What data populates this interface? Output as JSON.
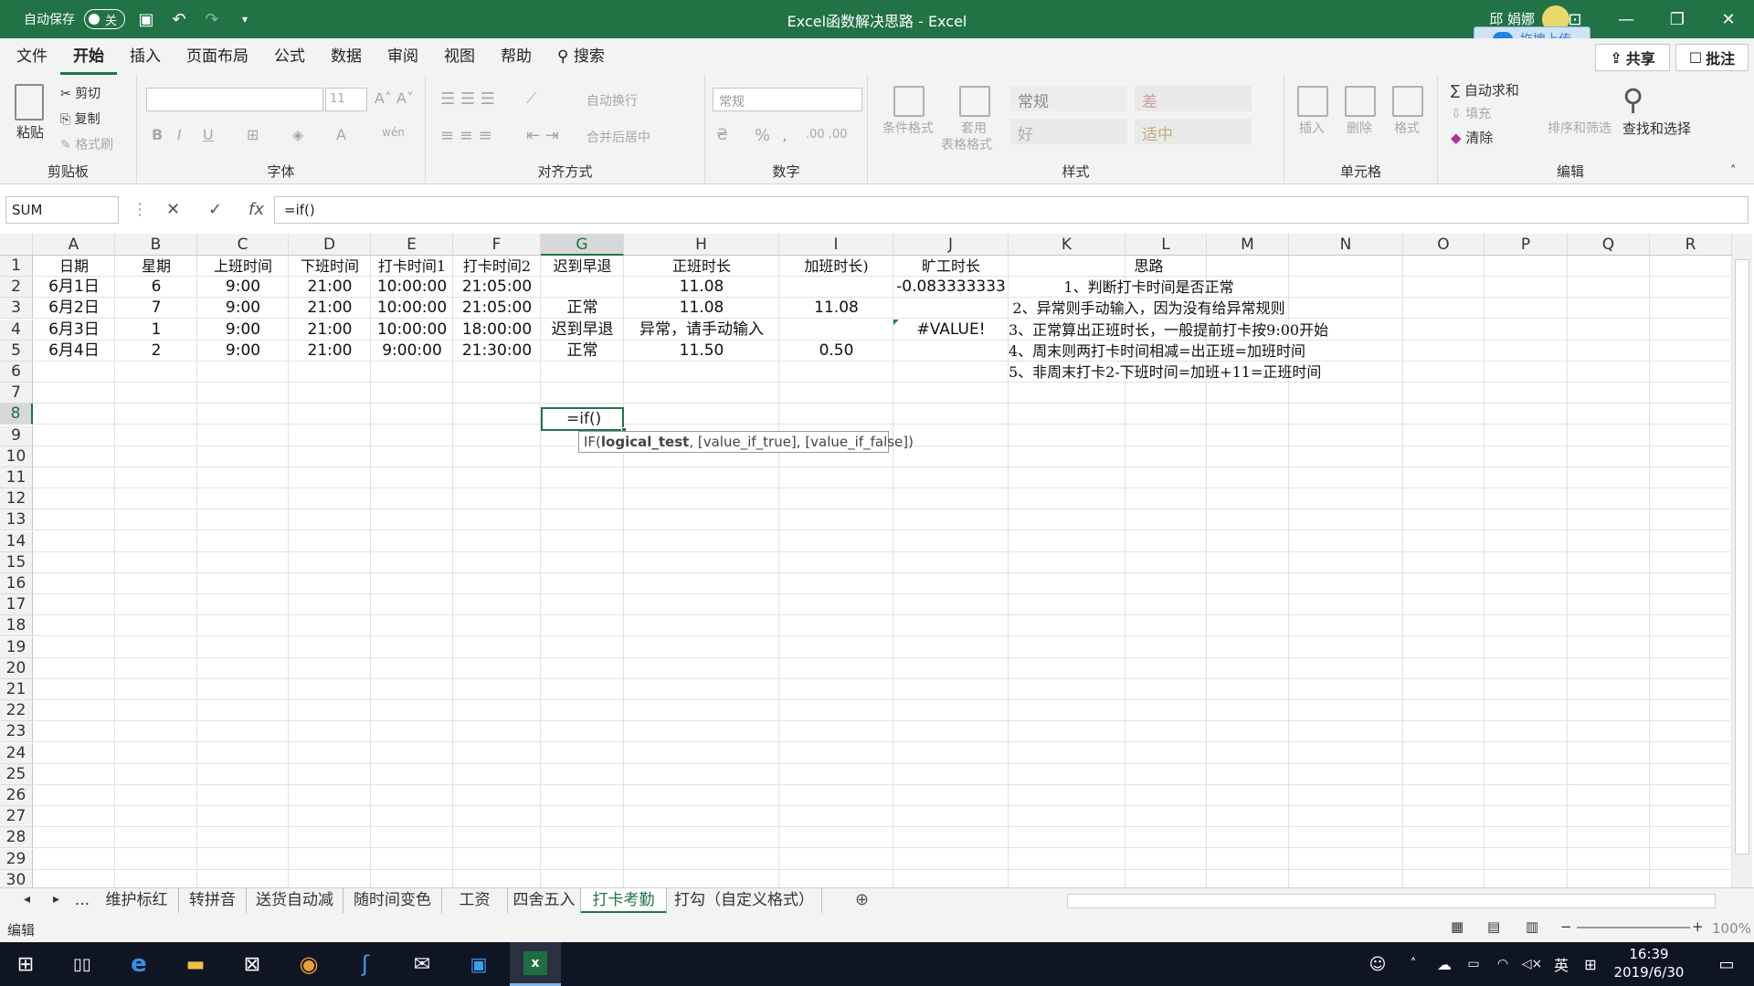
{
  "titlebar": {
    "autosave_label": "自动保存",
    "autosave_state": "关",
    "title": "Excel函数解决思路 - Excel",
    "user": "邱 娟娜",
    "upload": "拖拽上传"
  },
  "menu": {
    "tabs": [
      "文件",
      "开始",
      "插入",
      "页面布局",
      "公式",
      "数据",
      "审阅",
      "视图",
      "帮助"
    ],
    "active": "开始",
    "search": "搜索",
    "share": "共享",
    "comment": "批注"
  },
  "ribbon": {
    "clipboard": {
      "paste": "粘贴",
      "cut": "剪切",
      "copy": "复制",
      "format_painter": "格式刷",
      "label": "剪贴板"
    },
    "font": {
      "size": "11",
      "bold": "B",
      "italic": "I",
      "underline": "U",
      "label": "字体"
    },
    "alignment": {
      "wrap": "自动换行",
      "merge": "合并后居中",
      "label": "对齐方式"
    },
    "number": {
      "format": "常规",
      "label": "数字"
    },
    "styles": {
      "conditional": "条件格式",
      "table1": "套用",
      "table2": "表格格式",
      "normal": "常规",
      "bad": "差",
      "good": "好",
      "neutral": "适中",
      "label": "样式"
    },
    "cells": {
      "insert": "插入",
      "delete": "删除",
      "format": "格式",
      "label": "单元格"
    },
    "editing": {
      "autosum": "自动求和",
      "fill": "填充",
      "clear": "清除",
      "sort": "排序和筛选",
      "find": "查找和选择",
      "label": "编辑"
    }
  },
  "formula_bar": {
    "name_box": "SUM",
    "formula": "=if()"
  },
  "sheet": {
    "columns": [
      "A",
      "B",
      "C",
      "D",
      "E",
      "F",
      "G",
      "H",
      "I",
      "J",
      "K",
      "L",
      "M",
      "N",
      "O",
      "P",
      "Q",
      "R"
    ],
    "rows": [
      "1",
      "2",
      "3",
      "4",
      "5",
      "6",
      "7",
      "8",
      "9",
      "10",
      "11",
      "12",
      "13",
      "14",
      "15",
      "16",
      "17",
      "18",
      "19",
      "20",
      "21",
      "22",
      "23",
      "24",
      "25",
      "26",
      "27",
      "28",
      "29",
      "30"
    ],
    "header_row": [
      "日期",
      "星期",
      "上班时间",
      "下班时间",
      "打卡时间1",
      "打卡时间2",
      "迟到早退",
      "正班时长",
      "加班时长)",
      "旷工时长",
      "思路"
    ],
    "data": [
      [
        "6月1日",
        "6",
        "9:00",
        "21:00",
        "10:00:00",
        "21:05:00",
        "",
        "11.08",
        "",
        "-0.083333333",
        "1、判断打卡时间是否正常"
      ],
      [
        "6月2日",
        "7",
        "9:00",
        "21:00",
        "10:00:00",
        "21:05:00",
        "正常",
        "11.08",
        "11.08",
        "",
        "2、异常则手动输入，因为没有给异常规则"
      ],
      [
        "6月3日",
        "1",
        "9:00",
        "21:00",
        "10:00:00",
        "18:00:00",
        "迟到早退",
        "异常，请手动输入",
        "",
        "#VALUE!",
        "3、正常算出正班时长，一般提前打卡按9:00开始"
      ],
      [
        "6月4日",
        "2",
        "9:00",
        "21:00",
        "9:00:00",
        "21:30:00",
        "正常",
        "11.50",
        "0.50",
        "",
        "4、周末则两打卡时间相减=出正班=加班时间"
      ]
    ],
    "row6_note": "5、非周末打卡2-下班时间=加班+11=正班时间",
    "active_cell_text": "=if()",
    "tooltip_fn": "IF(",
    "tooltip_bold": "logical_test",
    "tooltip_rest": ", [value_if_true], [value_if_false])"
  },
  "sheet_tabs": [
    "...",
    "维护标红",
    "转拼音",
    "送货自动减",
    "随时间变色",
    "工资",
    "四舍五入",
    "打卡考勤",
    "打勾（自定义格式）"
  ],
  "active_sheet": "打卡考勤",
  "status": {
    "mode": "编辑",
    "zoom": "100%"
  },
  "taskbar": {
    "time": "16:39",
    "date": "2019/6/30",
    "lang": "英"
  },
  "colors": {
    "excel_green": "#217346",
    "ribbon_bg": "#f3f3f3",
    "taskbar_bg": "#101523"
  }
}
